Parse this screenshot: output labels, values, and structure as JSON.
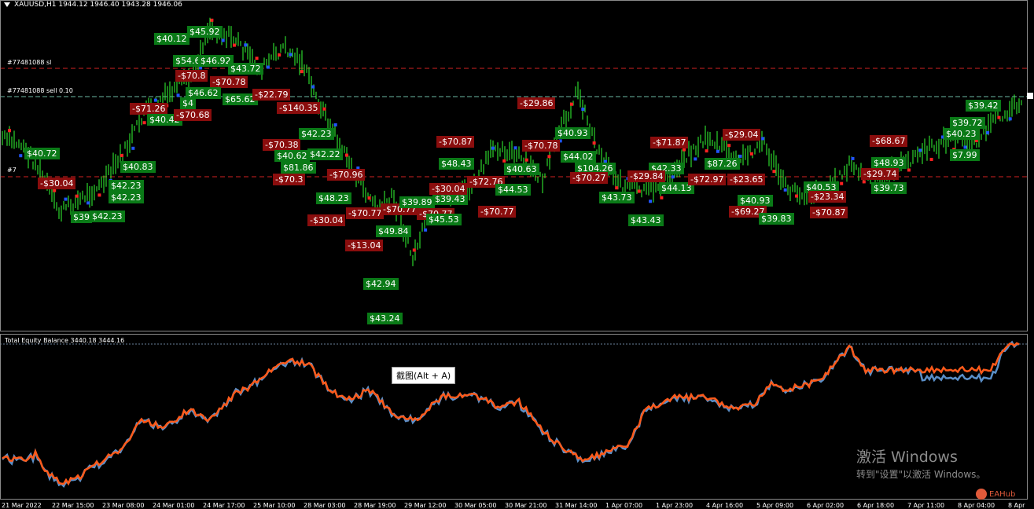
{
  "main": {
    "title": "XAUUSD,H1  1944.12 1946.40 1943.28 1946.06",
    "sl_label": "#77481088 sl",
    "sell_label": "#77481088 sell 0.10",
    "partial_label": "#7",
    "colors": {
      "bull_candle": "#33ff33",
      "bear_candle": "#33ff33",
      "sl_line": "#d22222",
      "entry_line": "#6cb7a4",
      "profit_bg": "#0a7a17",
      "loss_bg": "#8a0d0d"
    },
    "trade_labels": [
      {
        "text": "$40.12",
        "kind": "green"
      },
      {
        "text": "$45.92",
        "kind": "green"
      },
      {
        "text": "$54.6",
        "kind": "green"
      },
      {
        "text": "$46.92",
        "kind": "green"
      },
      {
        "text": "$43.72",
        "kind": "green"
      },
      {
        "text": "-$70.8",
        "kind": "red"
      },
      {
        "text": "-$70.78",
        "kind": "red"
      },
      {
        "text": "$46.62",
        "kind": "green"
      },
      {
        "text": "$4",
        "kind": "green"
      },
      {
        "text": "-$71.26",
        "kind": "red"
      },
      {
        "text": "$40.42",
        "kind": "green"
      },
      {
        "text": "-$70.68",
        "kind": "red"
      },
      {
        "text": "$65.62",
        "kind": "green"
      },
      {
        "text": "-$22.79",
        "kind": "red"
      },
      {
        "text": "-$140.35",
        "kind": "red"
      },
      {
        "text": "$42.23",
        "kind": "green"
      },
      {
        "text": "$40.72",
        "kind": "green"
      },
      {
        "text": "$40.83",
        "kind": "green"
      },
      {
        "text": "-$30.04",
        "kind": "red"
      },
      {
        "text": "$42.23",
        "kind": "green"
      },
      {
        "text": "$42.23",
        "kind": "green"
      },
      {
        "text": "$39",
        "kind": "green"
      },
      {
        "text": "$42.23",
        "kind": "green"
      },
      {
        "text": "-$70.38",
        "kind": "red"
      },
      {
        "text": "$40.62",
        "kind": "green"
      },
      {
        "text": "$42.22",
        "kind": "green"
      },
      {
        "text": "$81.86",
        "kind": "green"
      },
      {
        "text": "-$70.3",
        "kind": "red"
      },
      {
        "text": "-$70.96",
        "kind": "red"
      },
      {
        "text": "$48.23",
        "kind": "green"
      },
      {
        "text": "-$30.04",
        "kind": "red"
      },
      {
        "text": "-$70.77",
        "kind": "red"
      },
      {
        "text": "-$70.77",
        "kind": "red"
      },
      {
        "text": "$49.84",
        "kind": "green"
      },
      {
        "text": "-$13.04",
        "kind": "red"
      },
      {
        "text": "$42.94",
        "kind": "green"
      },
      {
        "text": "$43.24",
        "kind": "green"
      },
      {
        "text": "$39.89",
        "kind": "green"
      },
      {
        "text": "$39.43",
        "kind": "green"
      },
      {
        "text": "-$70.77",
        "kind": "red"
      },
      {
        "text": "$45.53",
        "kind": "green"
      },
      {
        "text": "-$30.04",
        "kind": "red"
      },
      {
        "text": "$48.43",
        "kind": "green"
      },
      {
        "text": "-$70.87",
        "kind": "red"
      },
      {
        "text": "-$72.76",
        "kind": "red"
      },
      {
        "text": "$40.63",
        "kind": "green"
      },
      {
        "text": "$44.53",
        "kind": "green"
      },
      {
        "text": "-$70.77",
        "kind": "red"
      },
      {
        "text": "-$70.78",
        "kind": "red"
      },
      {
        "text": "-$29.86",
        "kind": "red"
      },
      {
        "text": "$40.93",
        "kind": "green"
      },
      {
        "text": "$44.02",
        "kind": "green"
      },
      {
        "text": "$104.26",
        "kind": "green"
      },
      {
        "text": "-$70.27",
        "kind": "red"
      },
      {
        "text": "$43.73",
        "kind": "green"
      },
      {
        "text": "-$71.87",
        "kind": "red"
      },
      {
        "text": "$42.33",
        "kind": "green"
      },
      {
        "text": "-$29.84",
        "kind": "red"
      },
      {
        "text": "$44.13",
        "kind": "green"
      },
      {
        "text": "$43.43",
        "kind": "green"
      },
      {
        "text": "-$29.04",
        "kind": "red"
      },
      {
        "text": "$87.26",
        "kind": "green"
      },
      {
        "text": "-$72.97",
        "kind": "red"
      },
      {
        "text": "-$23.65",
        "kind": "red"
      },
      {
        "text": "$40.93",
        "kind": "green"
      },
      {
        "text": "-$69.27",
        "kind": "red"
      },
      {
        "text": "$39.83",
        "kind": "green"
      },
      {
        "text": "$40.53",
        "kind": "green"
      },
      {
        "text": "-$23.34",
        "kind": "red"
      },
      {
        "text": "-$70.87",
        "kind": "red"
      },
      {
        "text": "-$68.67",
        "kind": "red"
      },
      {
        "text": "$48.93",
        "kind": "green"
      },
      {
        "text": "-$29.74",
        "kind": "red"
      },
      {
        "text": "$39.73",
        "kind": "green"
      },
      {
        "text": "$39.42",
        "kind": "green"
      },
      {
        "text": "$39.72",
        "kind": "green"
      },
      {
        "text": "$40.23",
        "kind": "green"
      },
      {
        "text": "$7.99",
        "kind": "green"
      }
    ]
  },
  "sub": {
    "title": "Total Equity Balance 3440.18 3444.16",
    "colors": {
      "equity": "#5a8fc8",
      "balance": "#ff5a1a"
    }
  },
  "tooltip": {
    "text": "截图(Alt + A)"
  },
  "time_axis": {
    "ticks": [
      "21 Mar 2022",
      "22 Mar 15:00",
      "23 Mar 08:00",
      "24 Mar 01:00",
      "24 Mar 17:00",
      "25 Mar 10:00",
      "28 Mar 03:00",
      "28 Mar 19:00",
      "29 Mar 12:00",
      "30 Mar 05:00",
      "30 Mar 21:00",
      "31 Mar 14:00",
      "1 Apr 07:00",
      "1 Apr 23:00",
      "4 Apr 16:00",
      "5 Apr 09:00",
      "6 Apr 02:00",
      "6 Apr 18:00",
      "7 Apr 11:00",
      "8 Apr 04:00",
      "8 Apr"
    ]
  },
  "watermark": {
    "title": "激活 Windows",
    "subtitle": "转到\"设置\"以激活 Windows。"
  },
  "brand": {
    "text": "EAHub"
  }
}
